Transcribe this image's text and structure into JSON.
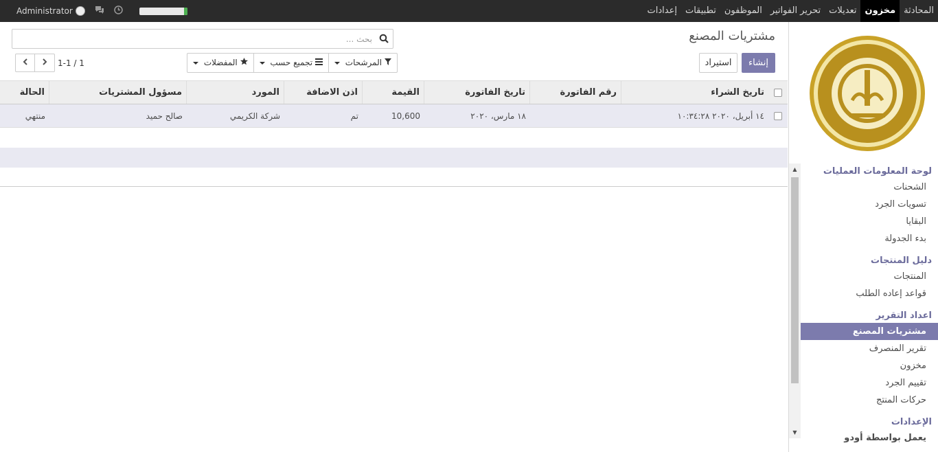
{
  "topbar": {
    "menu": [
      "المحادثة",
      "مخزون",
      "تعديلات",
      "تحرير الفواتير",
      "الموظفون",
      "تطبيقات",
      "إعدادات"
    ],
    "active_index": 1,
    "user_name": "Administrator",
    "accent_color": "#7c7bad"
  },
  "sidebar": {
    "logo_text": "Yemen International Food Industries Co.",
    "sections": [
      {
        "heading": "لوحة المعلومات العمليات",
        "items": [
          "الشحنات",
          "تسويات الجرد",
          "البقايا",
          "بدء الجدولة"
        ]
      },
      {
        "heading": "دليل المنتجات",
        "items": [
          "المنتجات",
          "قواعد إعاده الطلب"
        ]
      },
      {
        "heading": "اعداد التقرير",
        "items": [
          "مشتريات المصنع",
          "تقرير المنصرف",
          "مخزون",
          "تقييم الجرد",
          "حركات المنتج"
        ]
      },
      {
        "heading": "الإعدادات",
        "items": []
      }
    ],
    "active_item": "مشتريات المصنع",
    "powered_by": "يعمل بواسطة أودو"
  },
  "control_panel": {
    "title": "مشتريات المصنع",
    "create_label": "إنشاء",
    "import_label": "استيراد",
    "search_placeholder": "بحث ...",
    "filters_label": "المرشحات",
    "group_by_label": "تجميع حسب",
    "favorites_label": "المفضلات",
    "pager_value": "1-1 / 1"
  },
  "list": {
    "columns": [
      "تاريخ الشراء",
      "رقم الفاتورة",
      "تاريخ الفاتورة",
      "القيمة",
      "اذن الاضافة",
      "المورد",
      "مسؤول المشتريات",
      "الحالة"
    ],
    "rows": [
      [
        "١٤ أبريل، ٢٠٢٠ ١٠:٣٤:٢٨",
        "",
        "١٨ مارس، ٢٠٢٠",
        "10,600",
        "تم",
        "شركة الكريمي",
        "صالح حميد",
        "منتهي"
      ]
    ]
  }
}
